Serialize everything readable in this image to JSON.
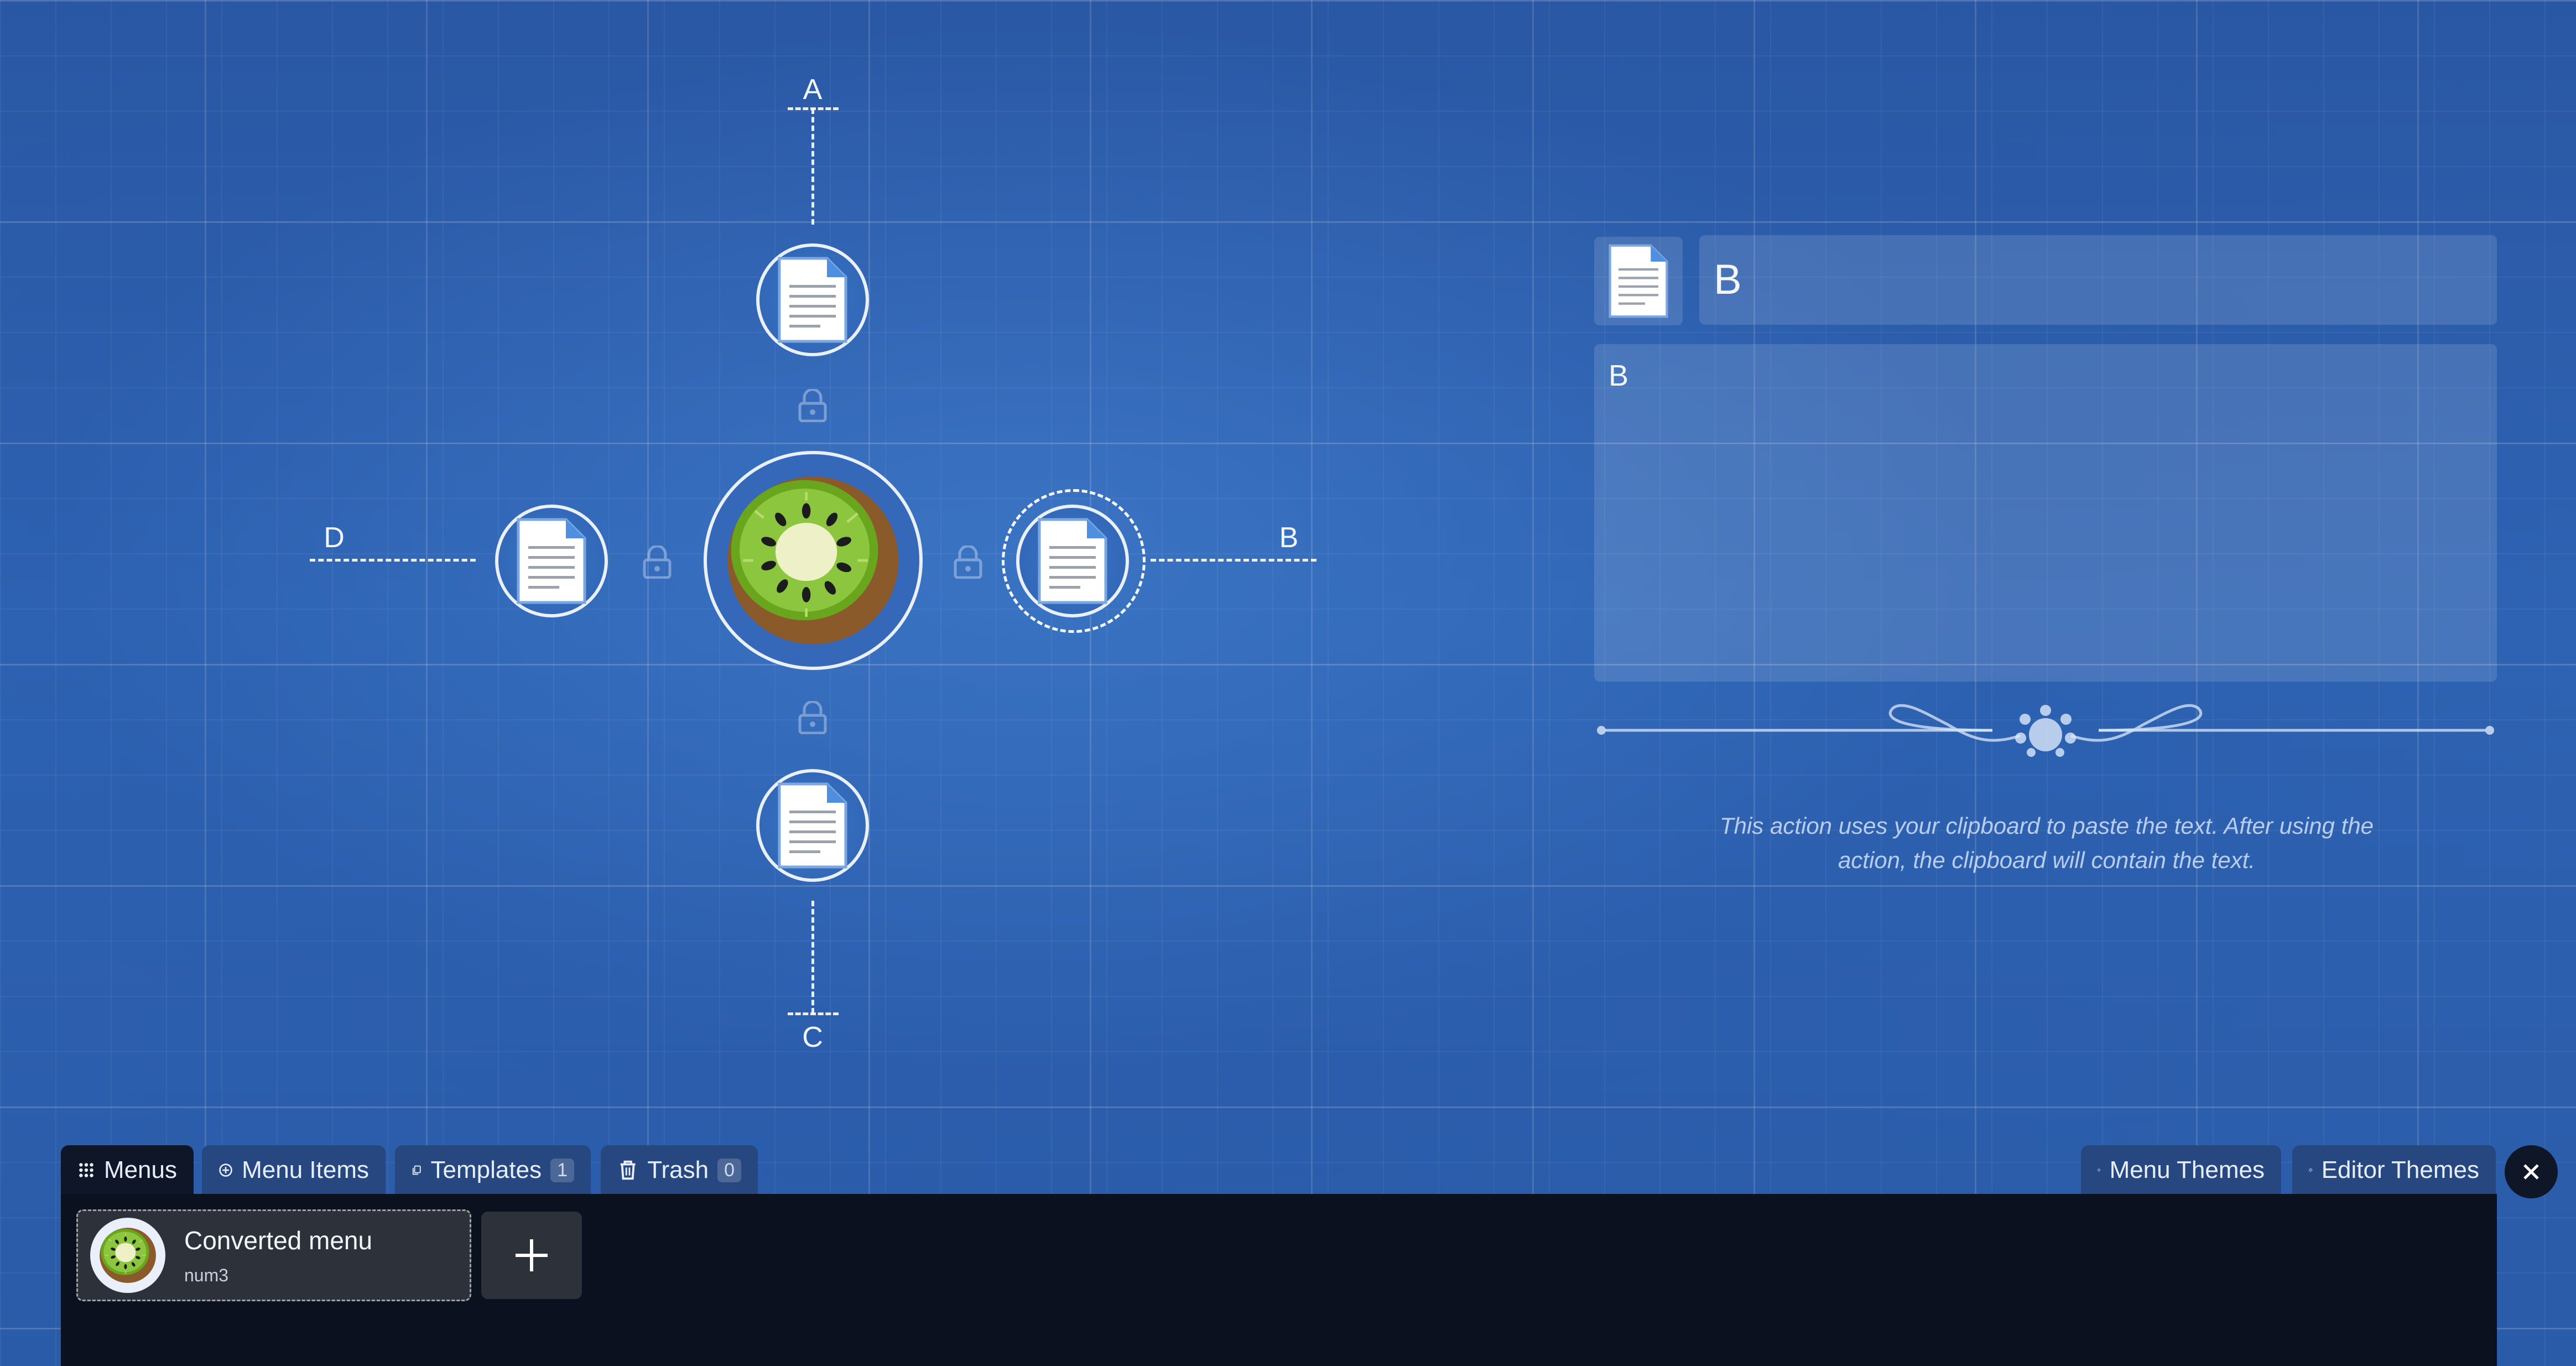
{
  "directions": {
    "top": "A",
    "right": "B",
    "bottom": "C",
    "left": "D"
  },
  "properties": {
    "item_name": "B",
    "item_text": "B",
    "hint": "This action uses your clipboard to paste the text. After using the action, the clipboard will contain the text."
  },
  "tabs": {
    "menus": "Menus",
    "menu_items": "Menu Items",
    "templates": "Templates",
    "templates_count": "1",
    "trash": "Trash",
    "trash_count": "0",
    "menu_themes": "Menu Themes",
    "editor_themes": "Editor Themes"
  },
  "menus": [
    {
      "title": "Converted menu",
      "shortcut": "num3"
    }
  ],
  "colors": {
    "background": "#2b5aa8",
    "drawer": "#0b111e",
    "tab": "#26477f"
  }
}
